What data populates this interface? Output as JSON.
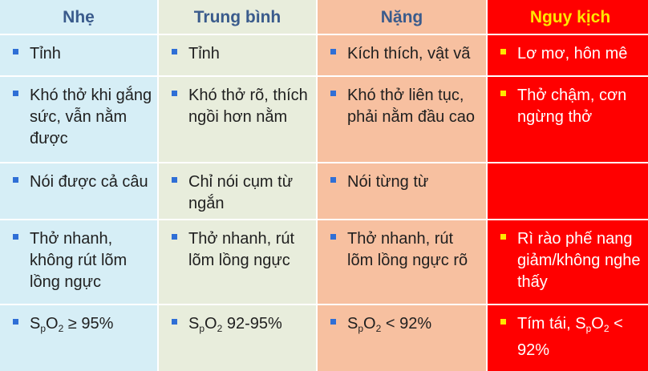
{
  "headers": [
    "Nhẹ",
    "Trung bình",
    "Nặng",
    "Nguy kịch"
  ],
  "rows": [
    [
      "Tỉnh",
      "Tỉnh",
      "Kích thích, vật vã",
      "Lơ mơ, hôn mê"
    ],
    [
      "Khó thở khi gắng sức, vẫn nằm được",
      "Khó thở rõ, thích ngồi hơn nằm",
      "Khó thở liên tục, phải nằm đầu cao",
      "Thở chậm, cơn ngừng thở"
    ],
    [
      "Nói được cả câu",
      "Chỉ nói cụm từ ngắn",
      "Nói từng từ",
      ""
    ],
    [
      "Thở nhanh, không rút lõm lồng ngực",
      "Thở nhanh, rút lõm lồng ngực",
      "Thở nhanh, rút lõm lồng ngực rõ",
      "Rì rào phế nang giảm/không nghe thấy"
    ]
  ],
  "spo2": {
    "s": "S",
    "p": "p",
    "o": "O",
    "two": "2",
    "v1": " ≥ 95%",
    "v2": " 92-95%",
    "v3": " < 92%",
    "v4_prefix": "Tím tái, ",
    "v4": " < 92%"
  },
  "colors": {
    "col_nhe": "#d6eef6",
    "col_trung_binh": "#e8eddc",
    "col_nang": "#f7c0a0",
    "col_nguy_kich": "#ff0000",
    "header_text": "#3a5b8c",
    "critical_header_text": "#ffe600",
    "bullet": "#2f6fd6",
    "critical_bullet": "#ffe600"
  }
}
